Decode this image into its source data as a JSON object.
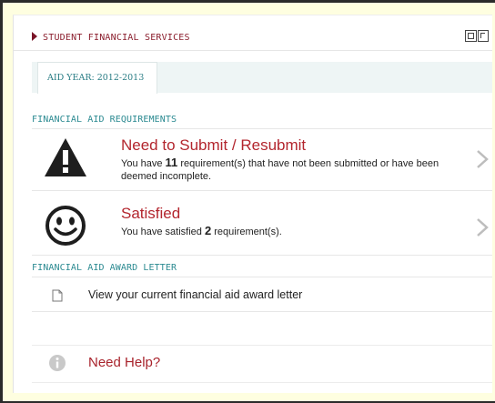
{
  "header": {
    "title": "STUDENT FINANCIAL SERVICES",
    "icons": [
      "restore-icon",
      "maximize-icon"
    ]
  },
  "tabs": [
    {
      "label": "AID YEAR: 2012-2013",
      "active": true
    }
  ],
  "requirements": {
    "section_title": "FINANCIAL AID REQUIREMENTS",
    "items": [
      {
        "title": "Need to Submit / Resubmit",
        "text_before": "You have ",
        "count": "11",
        "text_after": " requirement(s) that have not been submitted or have been deemed incomplete.",
        "icon": "warning-icon"
      },
      {
        "title": "Satisfied",
        "text_before": "You have satisfied ",
        "count": "2",
        "text_after": " requirement(s).",
        "icon": "smiley-icon"
      }
    ]
  },
  "award_letter": {
    "section_title": "FINANCIAL AID AWARD LETTER",
    "link_text": "View your current financial aid award letter",
    "icon": "document-icon"
  },
  "help": {
    "label": "Need Help?",
    "icon": "info-icon"
  },
  "colors": {
    "brand_red": "#b3262e",
    "teal": "#2b8a91",
    "page_bg": "#fefee0"
  }
}
